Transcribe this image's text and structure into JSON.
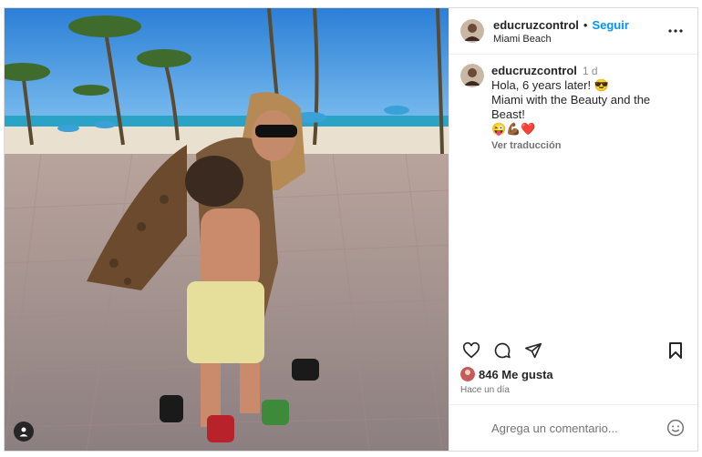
{
  "post": {
    "username": "educruzcontrol",
    "separator": "•",
    "follow_label": "Seguir",
    "location": "Miami Beach"
  },
  "caption": {
    "username": "educruzcontrol",
    "time": "1 d",
    "line1": "Hola, 6 years later! 😎",
    "line2": "Miami with the Beauty and the Beast!",
    "line3": "😜💪🏾❤️",
    "translate_label": "Ver traducción"
  },
  "engagement": {
    "likes": "846 Me gusta",
    "ago": "Hace un día"
  },
  "comment": {
    "placeholder": "Agrega un comentario..."
  },
  "icons": {
    "like": "heart-icon",
    "comment": "comment-icon",
    "share": "share-icon",
    "save": "bookmark-icon",
    "more": "more-icon",
    "emoji": "emoji-icon",
    "tag": "user-tag-icon"
  },
  "colors": {
    "accent": "#0095f6",
    "text": "#262626",
    "muted": "#737373"
  }
}
